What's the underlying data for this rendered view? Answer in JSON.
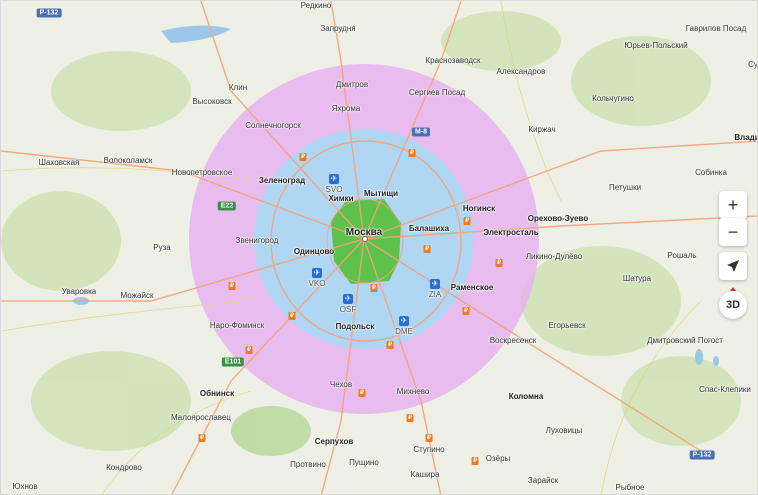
{
  "zoom": {
    "in_label": "+",
    "out_label": "−"
  },
  "view_3d_label": "3D",
  "colors": {
    "zone_outer": "#e6b3f0",
    "zone_middle": "#a9d8f2",
    "zone_inner": "#58c041",
    "roads": "#f4a27a",
    "water": "#9cc7e8"
  },
  "center_label": "Москва",
  "places": [
    {
      "name": "Запрудня",
      "style": "normal"
    },
    {
      "name": "Краснозаводск",
      "style": "normal"
    },
    {
      "name": "Гаврилов Посад",
      "style": "normal"
    },
    {
      "name": "Юрьев-Польский",
      "style": "normal"
    },
    {
      "name": "Александров",
      "style": "normal"
    },
    {
      "name": "Дмитров",
      "style": "normal"
    },
    {
      "name": "Сергиев Посад",
      "style": "normal"
    },
    {
      "name": "Клин",
      "style": "normal"
    },
    {
      "name": "Высоковск",
      "style": "normal"
    },
    {
      "name": "Яхрома",
      "style": "normal"
    },
    {
      "name": "Кольчугино",
      "style": "normal"
    },
    {
      "name": "Солнечногорск",
      "style": "normal"
    },
    {
      "name": "Киржач",
      "style": "normal"
    },
    {
      "name": "Шаховская",
      "style": "normal"
    },
    {
      "name": "Волоколамск",
      "style": "normal"
    },
    {
      "name": "Новопетровское",
      "style": "normal"
    },
    {
      "name": "Зеленоград",
      "style": "bold"
    },
    {
      "name": "Химки",
      "style": "bold"
    },
    {
      "name": "Мытищи",
      "style": "bold"
    },
    {
      "name": "Собинка",
      "style": "normal"
    },
    {
      "name": "Петушки",
      "style": "normal"
    },
    {
      "name": "Ногинск",
      "style": "bold"
    },
    {
      "name": "Орехово-Зуево",
      "style": "bold"
    },
    {
      "name": "Балашиха",
      "style": "bold"
    },
    {
      "name": "Электросталь",
      "style": "bold"
    },
    {
      "name": "Звенигород",
      "style": "normal"
    },
    {
      "name": "Руза",
      "style": "normal"
    },
    {
      "name": "Одинцово",
      "style": "bold"
    },
    {
      "name": "Ликино-Дулёво",
      "style": "normal"
    },
    {
      "name": "Рошаль",
      "style": "normal"
    },
    {
      "name": "Шатура",
      "style": "normal"
    },
    {
      "name": "Уваровка",
      "style": "normal"
    },
    {
      "name": "Можайск",
      "style": "normal"
    },
    {
      "name": "Раменское",
      "style": "bold"
    },
    {
      "name": "Наро-Фоминск",
      "style": "normal"
    },
    {
      "name": "Подольск",
      "style": "bold"
    },
    {
      "name": "Егорьевск",
      "style": "normal"
    },
    {
      "name": "Дмитровский Погост",
      "style": "normal"
    },
    {
      "name": "Воскресенск",
      "style": "normal"
    },
    {
      "name": "Спас-Клепики",
      "style": "normal"
    },
    {
      "name": "Обнинск",
      "style": "bold"
    },
    {
      "name": "Чехов",
      "style": "normal"
    },
    {
      "name": "Михнево",
      "style": "normal"
    },
    {
      "name": "Коломна",
      "style": "bold"
    },
    {
      "name": "Малоярославец",
      "style": "normal"
    },
    {
      "name": "Луховицы",
      "style": "normal"
    },
    {
      "name": "Серпухов",
      "style": "bold"
    },
    {
      "name": "Протвино",
      "style": "normal"
    },
    {
      "name": "Ступино",
      "style": "normal"
    },
    {
      "name": "Озёры",
      "style": "normal"
    },
    {
      "name": "Пущино",
      "style": "normal"
    },
    {
      "name": "Кондрово",
      "style": "normal"
    },
    {
      "name": "Кашира",
      "style": "normal"
    },
    {
      "name": "Зарайск",
      "style": "normal"
    },
    {
      "name": "Юхнов",
      "style": "normal"
    },
    {
      "name": "Рыбное",
      "style": "normal"
    },
    {
      "name": "Редкино",
      "style": "normal"
    },
    {
      "name": "Влади",
      "style": "bold"
    },
    {
      "name": "Су",
      "style": "normal"
    }
  ],
  "airports": [
    {
      "code": "SVO"
    },
    {
      "code": "VKO"
    },
    {
      "code": "OSF"
    },
    {
      "code": "DME"
    },
    {
      "code": "ZIA"
    }
  ],
  "route_shields": [
    "Р-132",
    "М-8",
    "Е22",
    "Е101",
    "Р-132"
  ]
}
